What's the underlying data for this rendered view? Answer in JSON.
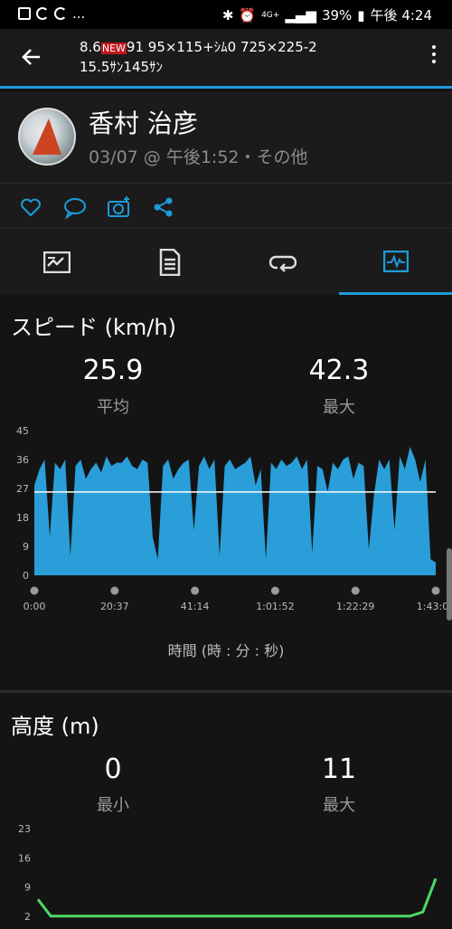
{
  "status_bar": {
    "left_more": "...",
    "battery": "39%",
    "time": "午後 4:24",
    "net": "4G+"
  },
  "app_bar": {
    "title_line1_a": "8.6",
    "title_badge": "NEW",
    "title_line1_b": "91 95×115+ｼﾑ0 725×225-2",
    "title_line2": "15.5ｻﾝ145ｻﾝ"
  },
  "profile": {
    "name": "香村 治彦",
    "subtitle": "03/07 @ 午後1:52・その他"
  },
  "actions": [
    "like",
    "comment",
    "add-photo",
    "share"
  ],
  "tabs": [
    {
      "name": "summary-tab",
      "icon": "chart-card-icon",
      "active": false
    },
    {
      "name": "details-tab",
      "icon": "document-icon",
      "active": false
    },
    {
      "name": "laps-tab",
      "icon": "loop-icon",
      "active": false
    },
    {
      "name": "charts-tab",
      "icon": "chart-icon",
      "active": true
    }
  ],
  "speed": {
    "title": "スピード (km/h)",
    "avg_value": "25.9",
    "avg_label": "平均",
    "max_value": "42.3",
    "max_label": "最大",
    "axis_title": "時間 (時 : 分 : 秒)"
  },
  "altitude": {
    "title": "高度 (m)",
    "min_value": "0",
    "min_label": "最小",
    "max_value": "11",
    "max_label": "最大"
  },
  "colors": {
    "accent": "#1d9bd9",
    "speed_fill": "#2a9ed8",
    "altitude_line": "#4cd964"
  },
  "chart_data": [
    {
      "type": "area",
      "series": [
        {
          "values": [
            28,
            33,
            36,
            12,
            35,
            33,
            36,
            6,
            34,
            36,
            30,
            33,
            35,
            32,
            37,
            34,
            35,
            35,
            37,
            34,
            33,
            36,
            35,
            12,
            5,
            34,
            36,
            30,
            33,
            35,
            36,
            14,
            34,
            37,
            33,
            36,
            6,
            34,
            36,
            33,
            34,
            35,
            37,
            28,
            33,
            5,
            35,
            33,
            36,
            34,
            35,
            37,
            33,
            36,
            7,
            34,
            33,
            26,
            35,
            33,
            36,
            37,
            30,
            35,
            34,
            8,
            25,
            36,
            33,
            36,
            14,
            37,
            33,
            40,
            36,
            29,
            36,
            5,
            4
          ]
        }
      ],
      "x_ticks": [
        "0:00",
        "20:37",
        "41:14",
        "1:01:52",
        "1:22:29",
        "1:43:06"
      ],
      "y_ticks": [
        "0",
        "9",
        "18",
        "27",
        "36",
        "45"
      ],
      "ylim": [
        0,
        45
      ],
      "average_line": 25.9,
      "xlabel": "時間 (時 : 分 : 秒)",
      "ylabel": "スピード (km/h)"
    },
    {
      "type": "line",
      "series": [
        {
          "values": [
            6,
            2,
            2,
            2,
            2,
            2,
            2,
            2,
            2,
            2,
            2,
            2,
            2,
            2,
            2,
            2,
            2,
            2,
            2,
            2,
            2,
            2,
            2,
            2,
            2,
            2,
            2,
            2,
            2,
            2,
            3,
            11
          ]
        }
      ],
      "y_ticks": [
        "2",
        "9",
        "16",
        "23"
      ],
      "ylim": [
        0,
        23
      ],
      "ylabel": "高度 (m)"
    }
  ]
}
